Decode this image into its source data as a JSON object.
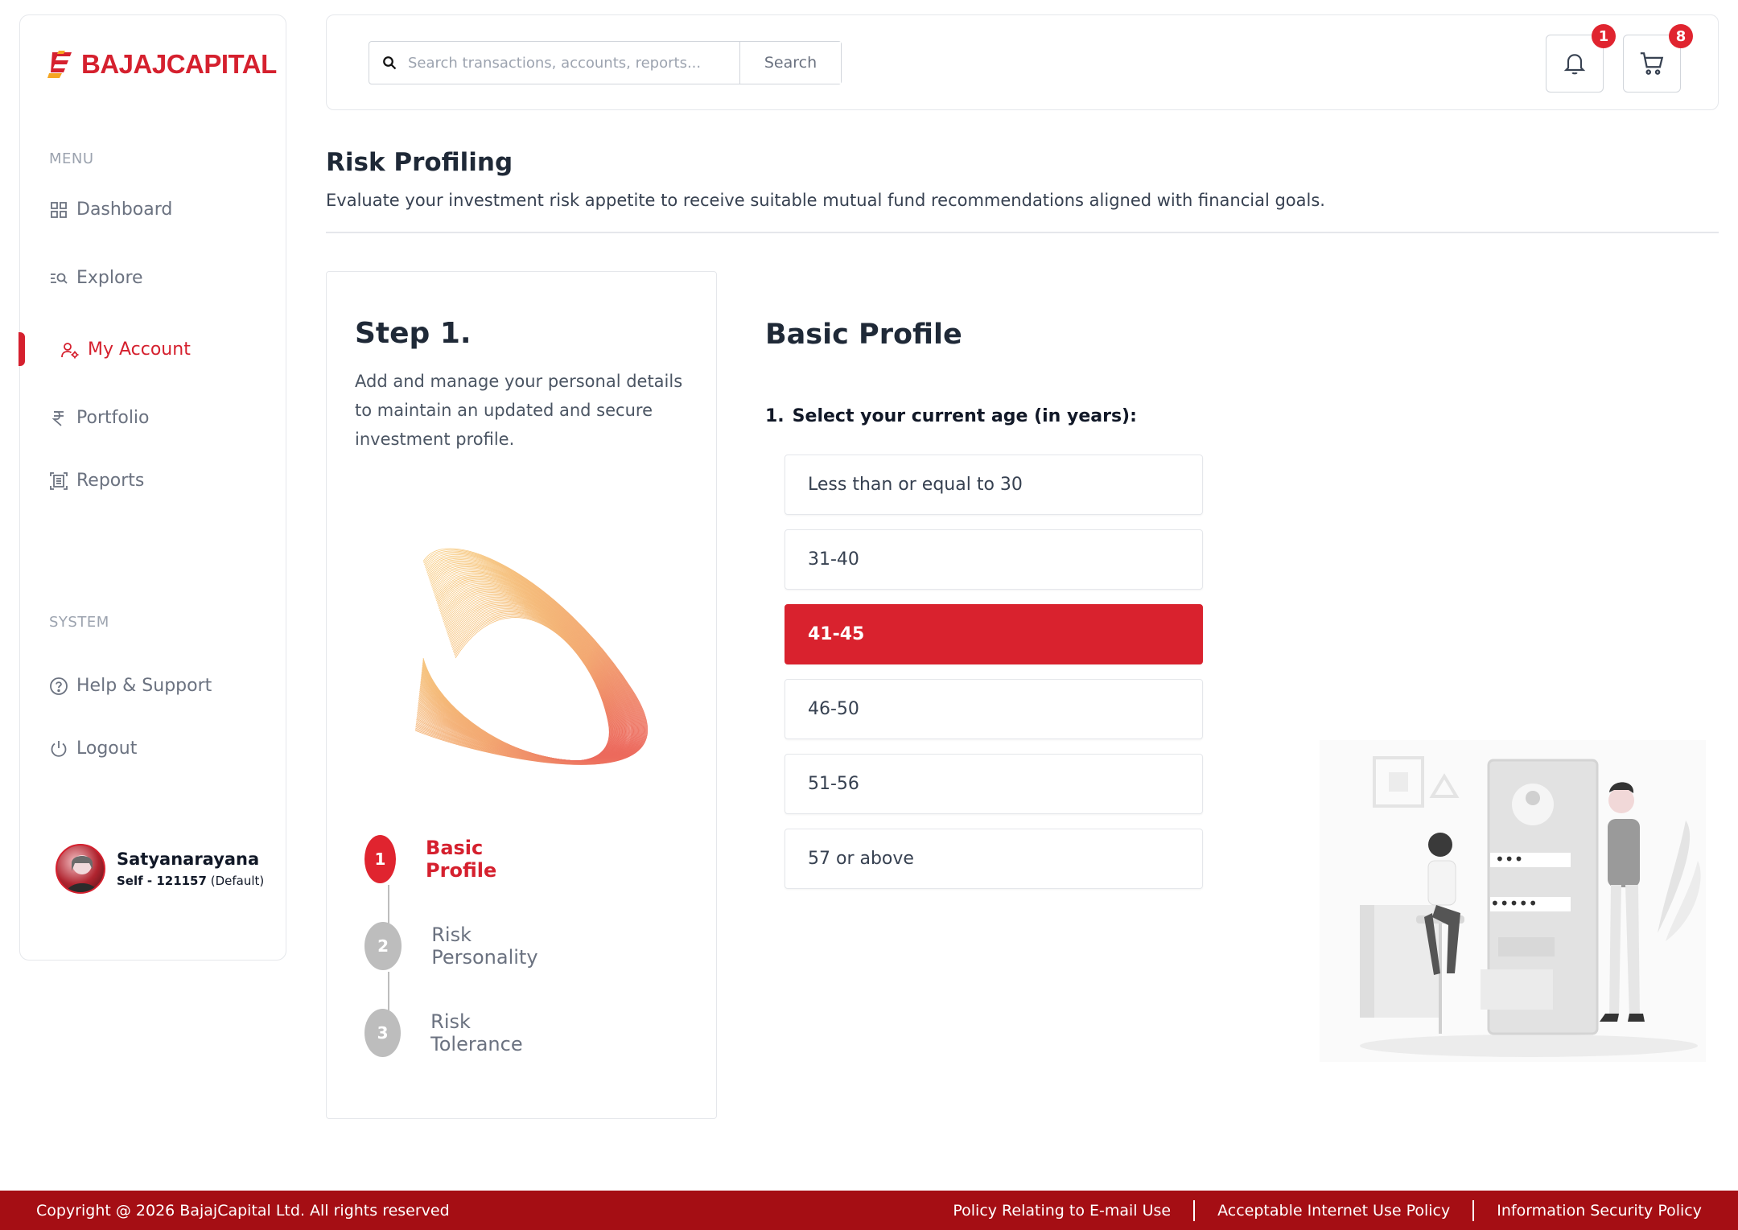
{
  "brand": {
    "name": "BAJAJCAPITAL",
    "color": "#d5202e"
  },
  "sidebar": {
    "menu_heading": "MENU",
    "items": [
      {
        "label": "Dashboard",
        "icon": "grid-icon"
      },
      {
        "label": "Explore",
        "icon": "explore-search-icon"
      },
      {
        "label": "My Account",
        "icon": "user-gear-icon",
        "active": true
      },
      {
        "label": "Portfolio",
        "icon": "rupee-icon"
      },
      {
        "label": "Reports",
        "icon": "report-icon"
      }
    ],
    "system_heading": "SYSTEM",
    "system_items": [
      {
        "label": "Help & Support",
        "icon": "help-icon"
      },
      {
        "label": "Logout",
        "icon": "power-icon"
      }
    ],
    "user": {
      "name": "Satyanarayana",
      "id_line": "Self - 121157",
      "default_tag": "(Default)"
    }
  },
  "header": {
    "search_placeholder": "Search transactions, accounts, reports...",
    "search_button": "Search",
    "notifications_count": "1",
    "cart_count": "8"
  },
  "page": {
    "title": "Risk Profiling",
    "subtitle": "Evaluate your investment risk appetite to receive suitable mutual fund recommendations aligned with financial goals."
  },
  "step_card": {
    "title": "Step 1.",
    "description": "Add and manage your personal details to maintain an updated and secure investment profile.",
    "steps": [
      {
        "number": "1",
        "label": "Basic Profile",
        "active": true
      },
      {
        "number": "2",
        "label": "Risk Personality",
        "active": false
      },
      {
        "number": "3",
        "label": "Risk Tolerance",
        "active": false
      }
    ]
  },
  "profile": {
    "title": "Basic Profile",
    "question_number": "1.",
    "question": "Select your current age (in years):",
    "options": [
      "Less than or equal to 30",
      "31-40",
      "41-45",
      "46-50",
      "51-56",
      "57 or above"
    ],
    "selected": "41-45"
  },
  "footer": {
    "copyright": "Copyright @ 2026 BajajCapital Ltd. All rights reserved",
    "links": [
      "Policy Relating to E-mail Use",
      "Acceptable Internet Use Policy",
      "Information Security Policy"
    ]
  }
}
